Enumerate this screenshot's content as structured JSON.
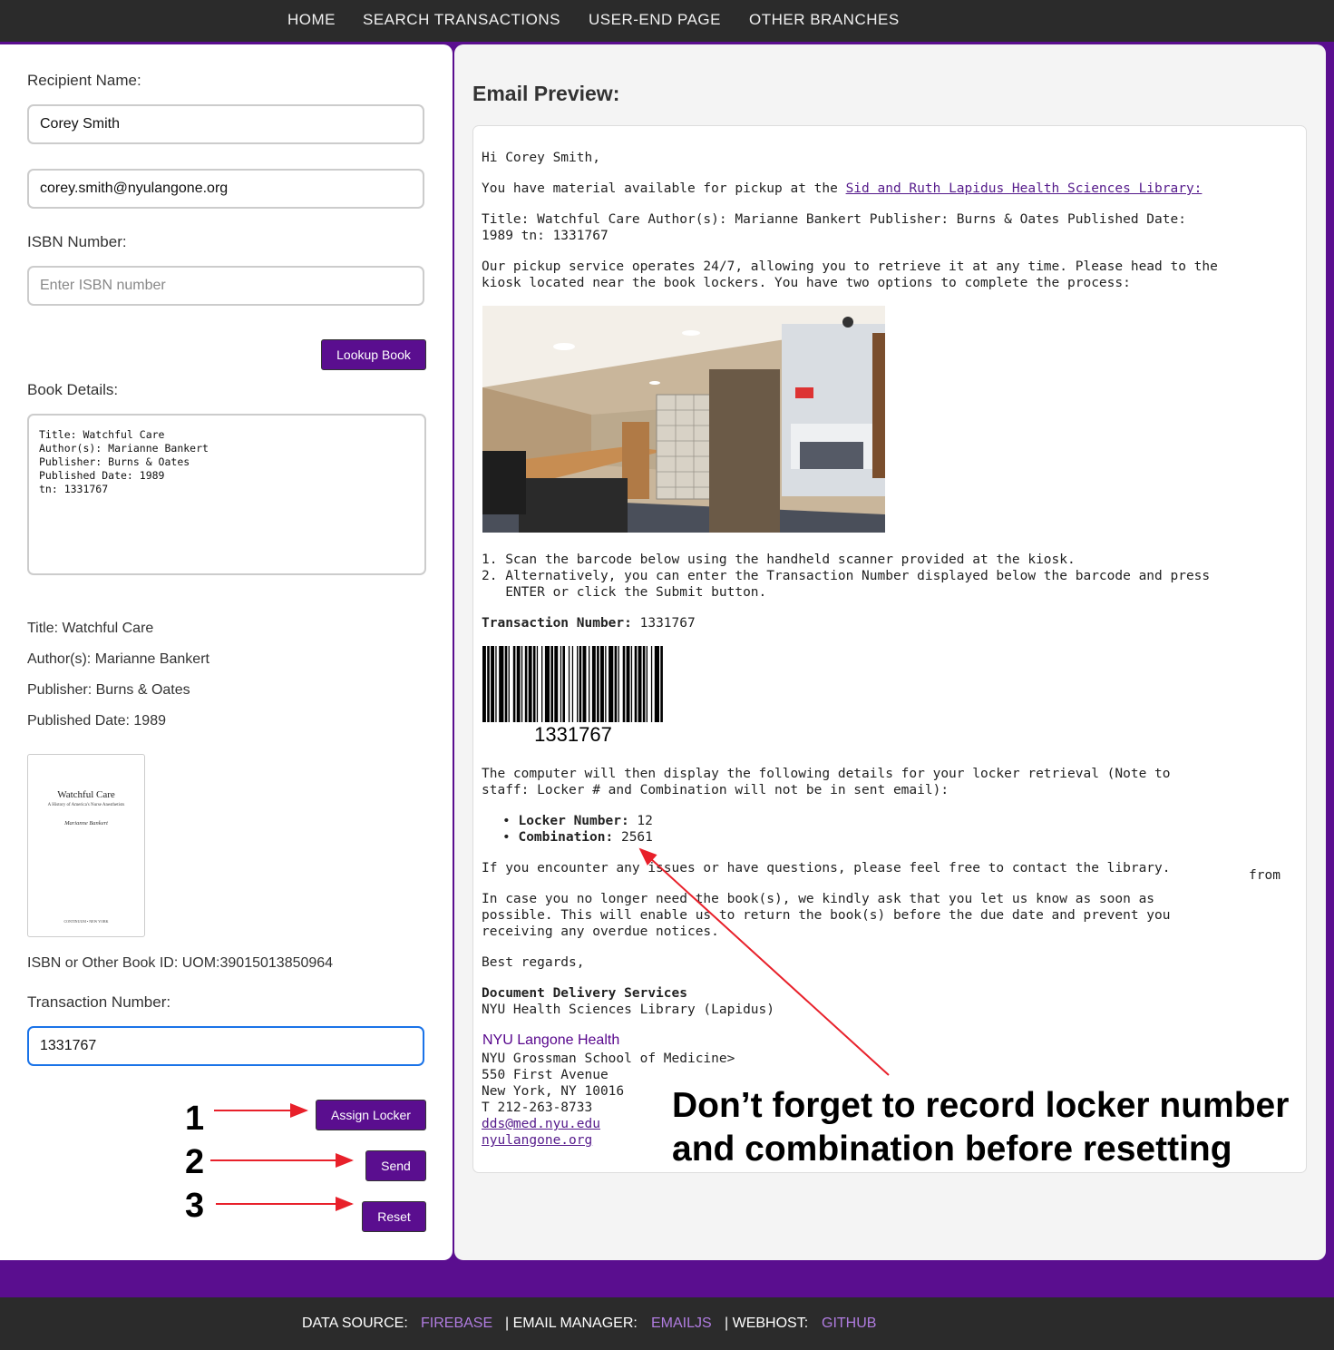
{
  "nav": {
    "items": [
      "HOME",
      "SEARCH TRANSACTIONS",
      "USER-END PAGE",
      "OTHER BRANCHES"
    ]
  },
  "form": {
    "recipient_label": "Recipient Name:",
    "recipient_value": "Corey Smith",
    "email_value": "corey.smith@nyulangone.org",
    "isbn_label": "ISBN Number:",
    "isbn_placeholder": "Enter ISBN number",
    "lookup_button": "Lookup Book",
    "book_details_label": "Book Details:",
    "book_details_text": "Title: Watchful Care\nAuthor(s): Marianne Bankert\nPublisher: Burns & Oates\nPublished Date: 1989\ntn: 1331767",
    "details": {
      "title": "Title: Watchful Care",
      "authors": "Author(s): Marianne Bankert",
      "publisher": "Publisher: Burns & Oates",
      "published": "Published Date: 1989"
    },
    "cover": {
      "title": "Watchful Care",
      "subtitle": "A History of America's Nurse Anesthetists",
      "author": "Marianne Bankert",
      "publisher_line": "CONTINUUM • NEW YORK"
    },
    "isbn_other": "ISBN or Other Book ID: UOM:39015013850964",
    "transaction_label": "Transaction Number:",
    "transaction_value": "1331767",
    "assign_button": "Assign Locker",
    "send_button": "Send",
    "reset_button": "Reset",
    "step_markers": [
      "1",
      "2",
      "3"
    ]
  },
  "email": {
    "heading": "Email Preview:",
    "greeting": "Hi Corey Smith,",
    "available_prefix": "You have material available for pickup at the ",
    "library_link": "Sid and Ruth Lapidus Health Sciences Library:",
    "book_line_1": "Title: Watchful Care Author(s): Marianne Bankert Publisher: Burns & Oates Published Date:",
    "book_line_2": "1989 tn: 1331767",
    "service_line_1": "Our pickup service operates 24/7, allowing you to retrieve it at any time. Please head to the",
    "service_line_2": "kiosk located near the book lockers. You have two options to complete the process:",
    "step1": "1. Scan the barcode below using the handheld scanner provided at the kiosk.",
    "step2_line_1": "2. Alternatively, you can enter the Transaction Number displayed below the barcode and press",
    "step2_line_2": "   ENTER or click the Submit button.",
    "txn_label": "Transaction Number:",
    "txn_value": " 1331767",
    "barcode_number": "1331767",
    "display_line_1": "The computer will then display the following details for your locker retrieval (Note to",
    "display_line_2": "staff: Locker # and Combination will not be in sent email):",
    "locker_label": "Locker Number:",
    "locker_value": " 12",
    "combo_label": "Combination:",
    "combo_value": " 2561",
    "contact_line": "If you encounter any issues or have questions, please feel free to contact the library.",
    "from_text": "from",
    "nolonger_line_1": "In case you no longer need the book(s), we kindly ask that you let us know as soon as",
    "nolonger_line_2": "possible. This will enable us to return the book(s) before the due date and prevent you",
    "nolonger_line_3": "receiving any overdue notices.",
    "regards": "Best regards,",
    "sig_dept": "Document Delivery Services",
    "sig_lib": "NYU Health Sciences Library (Lapidus)",
    "sig_org": "NYU Langone Health",
    "sig_school": "NYU Grossman School of Medicine>",
    "sig_addr1": "550 First Avenue",
    "sig_addr2": "New York, NY 10016",
    "sig_phone": "T 212-263-8733",
    "sig_email": "dds@med.nyu.edu",
    "sig_site": "nyulangone.org"
  },
  "callout": {
    "line1": "Don’t forget to record locker number",
    "line2": "and combination before resetting"
  },
  "footer": {
    "data_source_label": "DATA SOURCE:",
    "data_source_value": "FIREBASE",
    "email_manager_label": "| EMAIL MANAGER:",
    "email_manager_value": "EMAILJS",
    "webhost_label": "| WEBHOST:",
    "webhost_value": "GITHUB"
  },
  "colors": {
    "brand_purple": "#5a0e8f",
    "nav_bg": "#2b2b2b",
    "footer_link": "#b07ce0",
    "annotation_red": "#e8202a"
  }
}
